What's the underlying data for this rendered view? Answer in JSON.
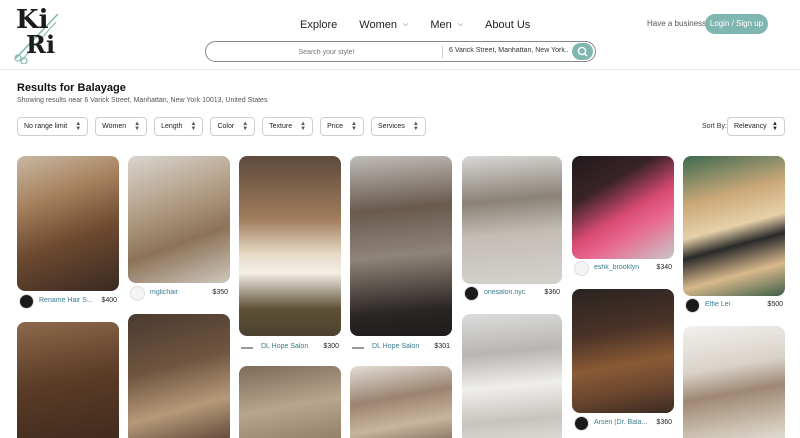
{
  "header": {
    "logo_text_top": "Ki",
    "logo_text_bottom": "Ri",
    "nav": [
      {
        "label": "Explore"
      },
      {
        "label": "Women",
        "chevron": true
      },
      {
        "label": "Men",
        "chevron": true
      },
      {
        "label": "About Us"
      }
    ],
    "business_label": "Have a business?",
    "login_label": "Login / Sign up"
  },
  "search": {
    "style_placeholder": "Search your style!",
    "location_value": "6 Varick Street, Manhattan, New York..."
  },
  "results": {
    "title": "Results for Balayage",
    "subtitle": "Showing results near 6 Varick Street, Manhattan, New York 10013, United States"
  },
  "filters": [
    {
      "label": "No range limit"
    },
    {
      "label": "Women"
    },
    {
      "label": "Length"
    },
    {
      "label": "Color"
    },
    {
      "label": "Texture"
    },
    {
      "label": "Price"
    },
    {
      "label": "Services"
    }
  ],
  "sort": {
    "label": "Sort By:",
    "value": "Relevancy"
  },
  "cards": [
    {
      "salon": "Rename Hair S...",
      "price": "$400",
      "avatar": "dark"
    },
    {
      "salon": "mglichair",
      "price": "$350",
      "avatar": "light"
    },
    {
      "salon": "DL Hope Salon",
      "price": "$300",
      "avatar": "dash"
    },
    {
      "salon": "DL Hope Salon",
      "price": "$301",
      "avatar": "dash"
    },
    {
      "salon": "onesalon.nyc",
      "price": "$360",
      "avatar": "dark"
    },
    {
      "salon": "eshk_brooklyn",
      "price": "$340",
      "avatar": "light"
    },
    {
      "salon": "Effie Lei",
      "price": "$500",
      "avatar": "dark"
    },
    {
      "salon": "Arsen (Dr. Bala...",
      "price": "$360",
      "avatar": "dark"
    }
  ],
  "colors": {
    "accent": "#7fb7b0",
    "salon_link": "#3a7d8e"
  }
}
